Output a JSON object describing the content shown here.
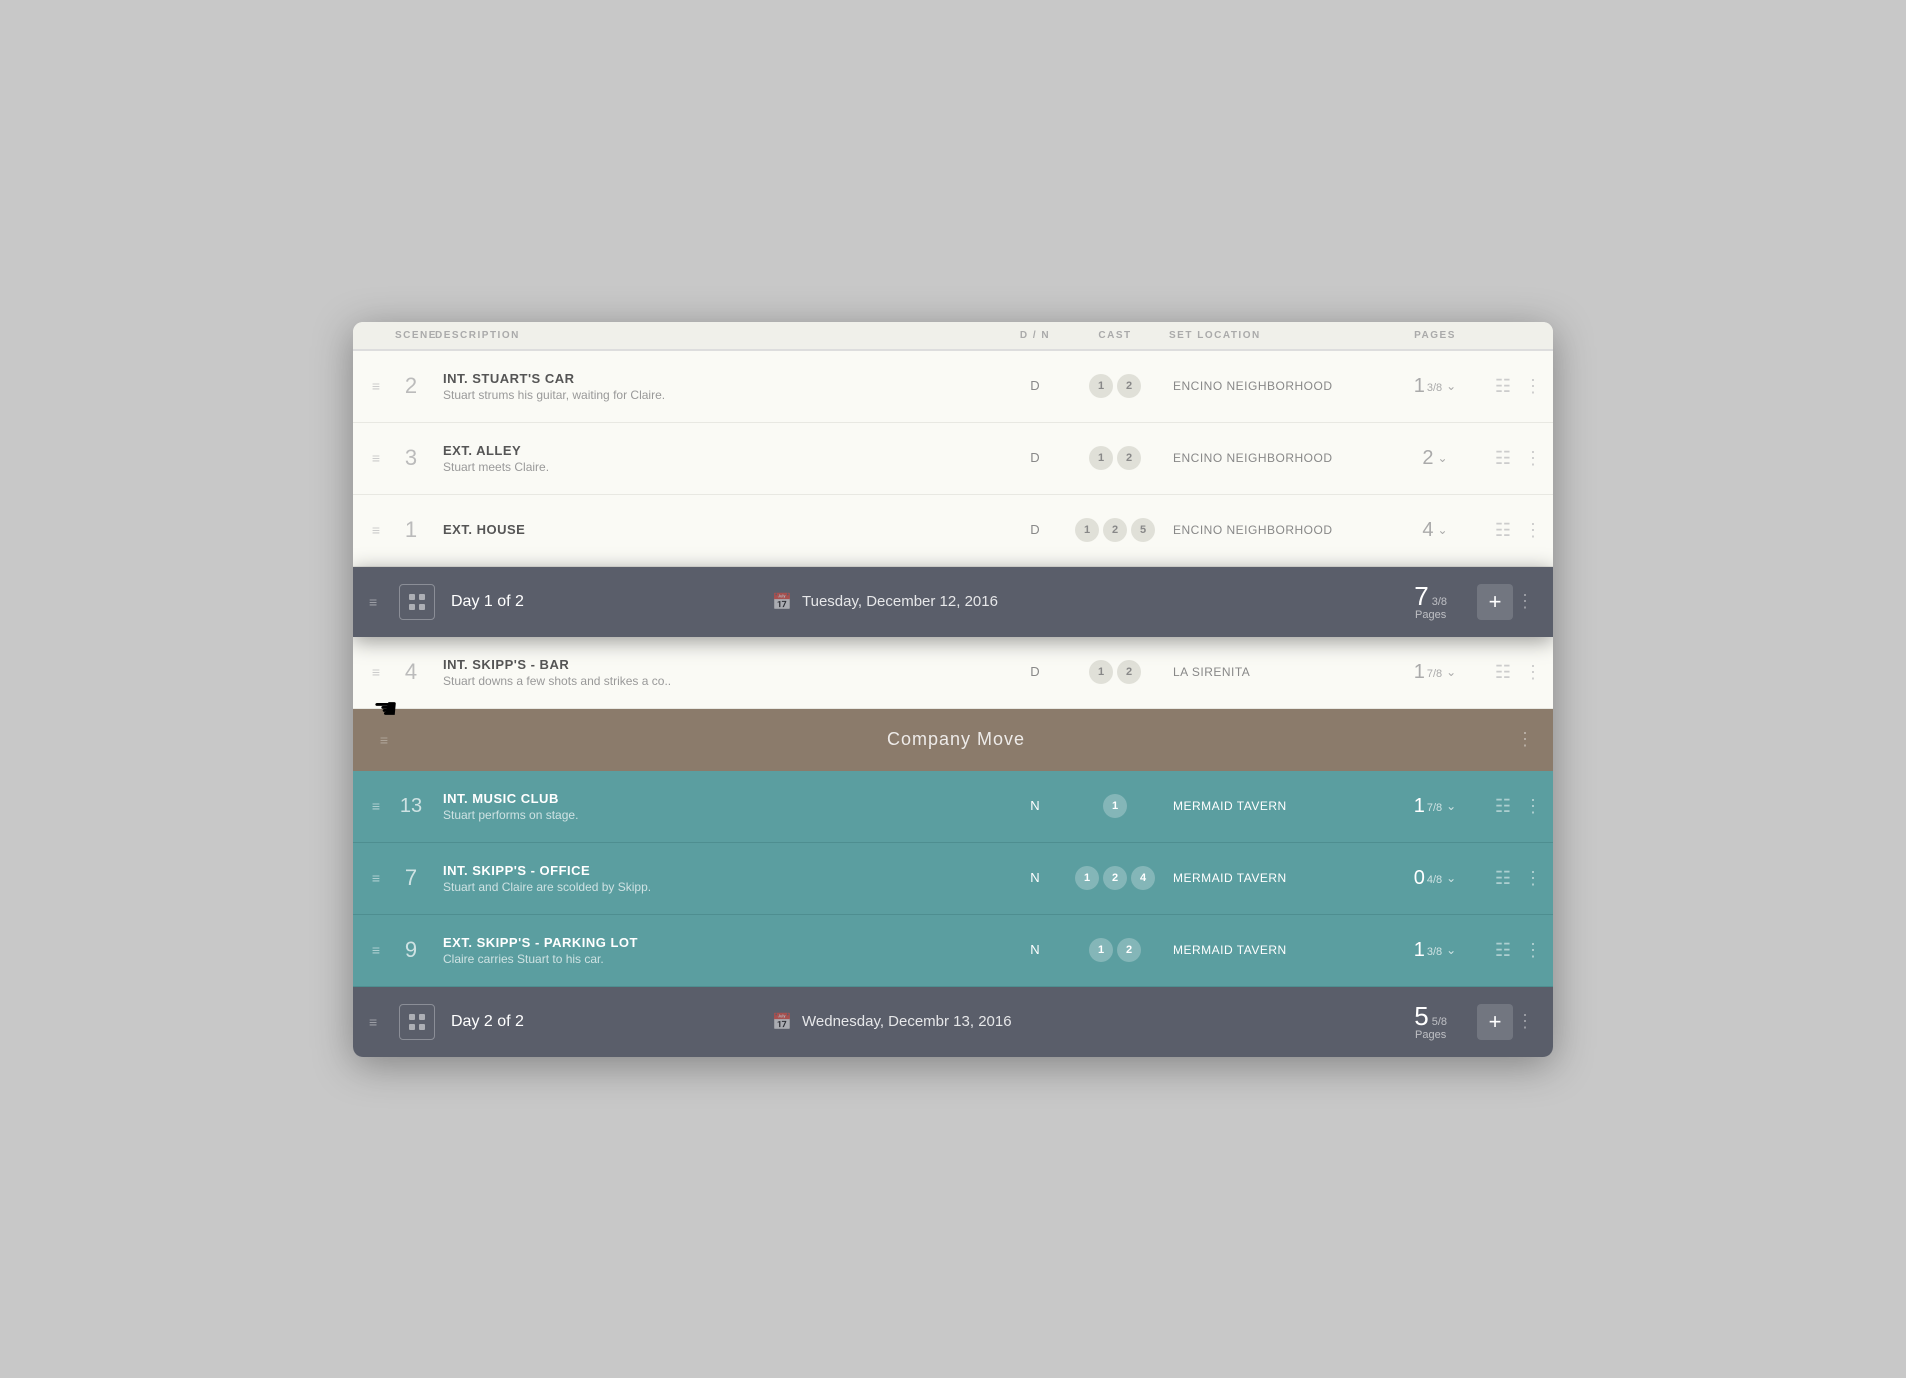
{
  "columns": {
    "scene": "Scene",
    "description": "Description",
    "dm": "D / N",
    "cast": "Cast",
    "set_location": "Set Location",
    "pages": "Pages"
  },
  "day1": {
    "label": "Day 1 of 2",
    "date": "Tuesday, December 12, 2016",
    "pages_num": "7",
    "pages_frac": "3/8",
    "pages_label": "Pages",
    "add_btn": "+"
  },
  "day2": {
    "label": "Day 2 of 2",
    "date": "Wednesday, Decembr 13, 2016",
    "pages_num": "5",
    "pages_frac": "5/8",
    "pages_label": "Pages",
    "add_btn": "+"
  },
  "company_move": {
    "label": "Company Move"
  },
  "rows": [
    {
      "id": "row-2",
      "num": "2",
      "title": "INT. STUART'S CAR",
      "desc": "Stuart strums his guitar, waiting for Claire.",
      "dm": "D",
      "cast": [
        "1",
        "2"
      ],
      "set_location": "ENCINO NEIGHBORHOOD",
      "pages_val": "1",
      "pages_frac": "3/8",
      "teal": false
    },
    {
      "id": "row-3",
      "num": "3",
      "title": "EXT. ALLEY",
      "desc": "Stuart meets Claire.",
      "dm": "D",
      "cast": [
        "1",
        "2"
      ],
      "set_location": "ENCINO NEIGHBORHOOD",
      "pages_val": "2",
      "pages_frac": "",
      "teal": false
    },
    {
      "id": "row-1",
      "num": "1",
      "title": "EXT. HOUSE",
      "desc": "...",
      "dm": "D",
      "cast": [
        "1",
        "2",
        "5"
      ],
      "set_location": "ENCINO NEIGHBORHOOD",
      "pages_val": "4",
      "pages_frac": "",
      "teal": false
    },
    {
      "id": "row-4",
      "num": "4",
      "title": "INT. SKIPP'S - BAR",
      "desc": "Stuart downs a few shots and strikes a co..",
      "dm": "D",
      "cast": [
        "1",
        "2"
      ],
      "set_location": "LA SIRENITA",
      "pages_val": "1",
      "pages_frac": "7/8",
      "teal": false
    },
    {
      "id": "row-13",
      "num": "13",
      "title": "INT. MUSIC CLUB",
      "desc": "Stuart performs on stage.",
      "dm": "N",
      "cast": [
        "1"
      ],
      "set_location": "MERMAID TAVERN",
      "pages_val": "1",
      "pages_frac": "7/8",
      "teal": true
    },
    {
      "id": "row-7",
      "num": "7",
      "title": "INT. SKIPP'S - OFFICE",
      "desc": "Stuart and Claire are scolded by Skipp.",
      "dm": "N",
      "cast": [
        "1",
        "2",
        "4"
      ],
      "set_location": "MERMAID TAVERN",
      "pages_val": "0",
      "pages_frac": "4/8",
      "teal": true
    },
    {
      "id": "row-9",
      "num": "9",
      "title": "EXT. SKIPP'S - PARKING LOT",
      "desc": "Claire carries Stuart to his car.",
      "dm": "N",
      "cast": [
        "1",
        "2"
      ],
      "set_location": "MERMAID TAVERN",
      "pages_val": "1",
      "pages_frac": "3/8",
      "teal": true
    }
  ]
}
